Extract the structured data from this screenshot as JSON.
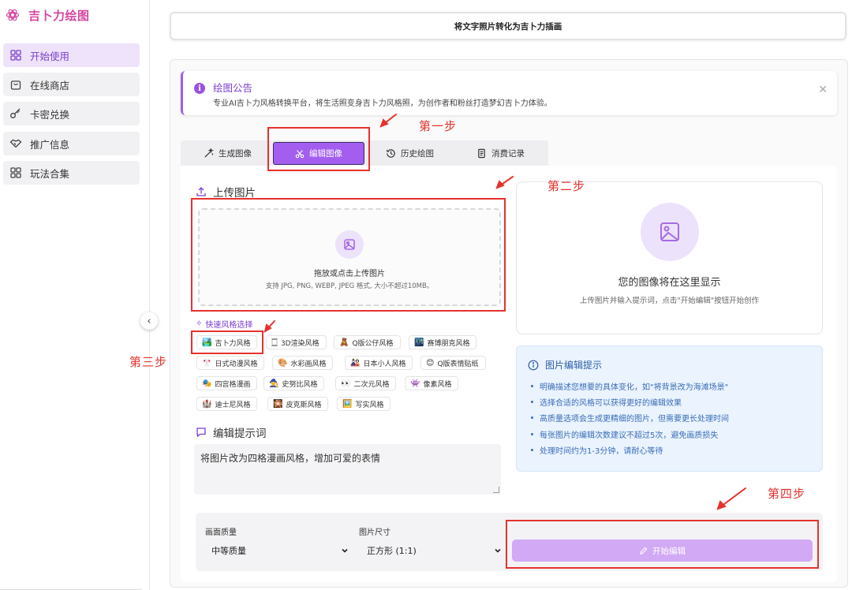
{
  "brand": {
    "name": "吉卜力绘图"
  },
  "sidebar": {
    "items": [
      {
        "label": "开始使用",
        "icon": "grid-icon",
        "active": true
      },
      {
        "label": "在线商店",
        "icon": "shopping-bag-icon",
        "active": false
      },
      {
        "label": "卡密兑换",
        "icon": "key-icon",
        "active": false
      },
      {
        "label": "推广信息",
        "icon": "handshake-icon",
        "active": false
      },
      {
        "label": "玩法合集",
        "icon": "grid-icon",
        "active": false
      }
    ]
  },
  "header": {
    "title": "将文字照片转化为吉卜力插画"
  },
  "notice": {
    "title": "绘图公告",
    "text": "专业AI吉卜力风格转换平台，将生活照变身吉卜力风格照，为创作者和粉丝打造梦幻吉卜力体验。"
  },
  "tabs": [
    {
      "label": "生成图像",
      "icon": "magic-wand-icon"
    },
    {
      "label": "编辑图像",
      "icon": "scissors-icon",
      "active": true
    },
    {
      "label": "历史绘图",
      "icon": "history-icon"
    },
    {
      "label": "消费记录",
      "icon": "receipt-icon"
    }
  ],
  "upload": {
    "heading": "上传图片",
    "dropzone_title": "拖放或点击上传图片",
    "dropzone_hint": "支持 JPG, PNG, WEBP, JPEG 格式, 大小不超过10MB。"
  },
  "preview": {
    "title": "您的图像将在这里显示",
    "subtitle": "上传图片并输入提示词，点击\"开始编辑\"按钮开始创作"
  },
  "quick_styles": {
    "label": "快速风格选择",
    "items": [
      {
        "emoji": "🏞️",
        "label": "吉卜力风格"
      },
      {
        "emoji": "🀆",
        "label": "3D渲染风格"
      },
      {
        "emoji": "🧸",
        "label": "Q版公仔风格"
      },
      {
        "emoji": "🌃",
        "label": "赛博朋克风格"
      },
      {
        "emoji": "🎌",
        "label": "日式动漫风格"
      },
      {
        "emoji": "🎨",
        "label": "水彩画风格"
      },
      {
        "emoji": "🎎",
        "label": "日本小人风格"
      },
      {
        "emoji": "😊",
        "label": "Q版表情贴纸"
      },
      {
        "emoji": "🎭",
        "label": "四宫格漫画"
      },
      {
        "emoji": "🧙",
        "label": "史努比风格"
      },
      {
        "emoji": "👀",
        "label": "二次元风格"
      },
      {
        "emoji": "👾",
        "label": "像素风格"
      },
      {
        "emoji": "🏰",
        "label": "迪士尼风格"
      },
      {
        "emoji": "🎇",
        "label": "皮克斯风格"
      },
      {
        "emoji": "🖼️",
        "label": "写实风格"
      }
    ]
  },
  "prompt": {
    "heading": "编辑提示词",
    "value": "将图片改为四格漫画风格，增加可爱的表情"
  },
  "tips": {
    "title": "图片编辑提示",
    "items": [
      "明确描述您想要的具体变化，如\"将背景改为海滩场景\"",
      "选择合适的风格可以获得更好的编辑效果",
      "高质量选项会生成更精细的图片，但需要更长处理时间",
      "每张图片的编辑次数建议不超过5次，避免画质损失",
      "处理时间约为1-3分钟，请耐心等待"
    ]
  },
  "settings": {
    "quality_label": "画面质量",
    "quality_value": "中等质量",
    "size_label": "图片尺寸",
    "size_value": "正方形 (1:1)",
    "submit_label": "开始编辑"
  },
  "annotations": {
    "step1": "第一步",
    "step2": "第二步",
    "step3": "第三步",
    "step4": "第四步"
  },
  "colors": {
    "accent": "#a35ef0",
    "brand": "#d646a0",
    "annotation": "#e5322d",
    "tips_text": "#3b6db8"
  }
}
